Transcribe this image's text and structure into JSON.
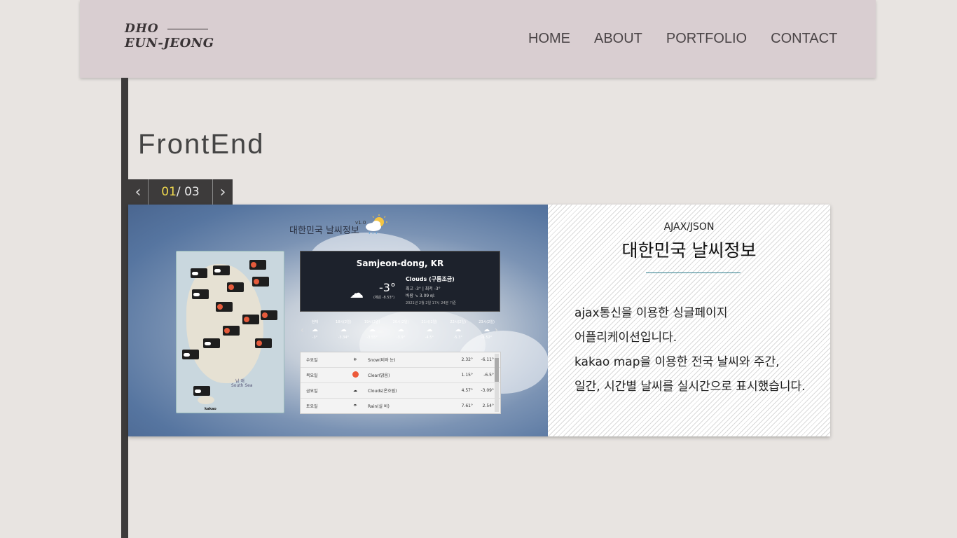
{
  "header": {
    "logo_line1": "DHO",
    "logo_line2": "EUN-JEONG",
    "nav": [
      "HOME",
      "ABOUT",
      "PORTFOLIO",
      "CONTACT"
    ]
  },
  "section": {
    "title": "FrontEnd"
  },
  "pager": {
    "current": "01",
    "separator": "/",
    "total": "03",
    "prev_icon": "chevron-left-icon",
    "next_icon": "chevron-right-icon"
  },
  "project": {
    "screenshot": {
      "app_title": "대한민국 날씨정보",
      "version": "v1.0",
      "now": {
        "place": "Samjeon-dong, KR",
        "temp": "-3°",
        "feels": "(체감 -8.53°)",
        "condition": "Clouds (구름조금)",
        "hilo": "최고 -3° | 최저 -3°",
        "wind": "바람 ➘ 3.09 ㎧",
        "time": "2021년 2월 2일 17시 24분 기준"
      },
      "hourly": [
        {
          "label": "현재",
          "temp": "-3°"
        },
        {
          "label": "18시(2일)",
          "temp": "-3.34°"
        },
        {
          "label": "19시(2일)",
          "temp": "-3.55°"
        },
        {
          "label": "20시(2일)",
          "temp": "-3.9°"
        },
        {
          "label": "21시(2일)",
          "temp": "-4.5°"
        },
        {
          "label": "22시(2일)",
          "temp": "-5.3°"
        },
        {
          "label": "23시(2일)",
          "temp": "-5.52°"
        }
      ],
      "weekly": [
        {
          "day": "수요일",
          "cond": "Snow(비와 눈)",
          "hi": "2.32°",
          "lo": "-6.11°"
        },
        {
          "day": "목요일",
          "cond": "Clear(맑음)",
          "hi": "1.15°",
          "lo": "-6.5°"
        },
        {
          "day": "금요일",
          "cond": "Clouds(온흐림)",
          "hi": "4.57°",
          "lo": "-3.09°"
        },
        {
          "day": "토요일",
          "cond": "Rain(실 비)",
          "hi": "7.61°",
          "lo": "2.54°"
        }
      ],
      "map_sea_label": "남 해",
      "map_sea_label_en": "South Sea",
      "map_brand": "kakao"
    },
    "category": "AJAX/JSON",
    "title": "대한민국 날씨정보",
    "description": [
      "ajax통신을 이용한 싱글페이지",
      "어플리케이션입니다.",
      "kakao map을 이용한 전국 날씨와 주간,",
      "일간, 시간별 날씨를 실시간으로 표시했습니다."
    ]
  },
  "colors": {
    "header_bg": "#d9ced1",
    "page_bg": "#e8e4e1",
    "bar": "#3d3b3b",
    "pager_current": "#f0d94e",
    "rule": "#2a7b8a"
  }
}
